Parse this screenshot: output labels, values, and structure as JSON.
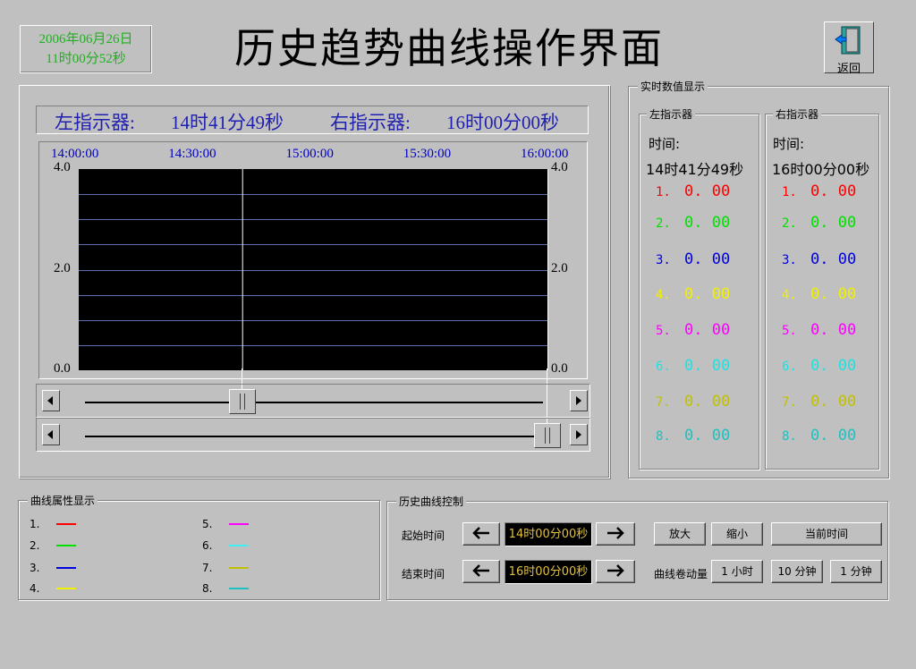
{
  "header": {
    "date": "2006年06月26日",
    "time": "11时00分52秒",
    "title": "历史趋势曲线操作界面",
    "exit_label": "返回"
  },
  "indicators": {
    "left_label": "左指示器:",
    "left_time": "14时41分49秒",
    "right_label": "右指示器:",
    "right_time": "16时00分00秒"
  },
  "chart_data": {
    "type": "line",
    "x_ticks": [
      "14:00:00",
      "14:30:00",
      "15:00:00",
      "15:30:00",
      "16:00:00"
    ],
    "y_ticks_left": [
      "4.0",
      "2.0",
      "0.0"
    ],
    "y_ticks_right": [
      "4.0",
      "2.0",
      "0.0"
    ],
    "ylim": [
      0,
      4
    ],
    "background": "#000000",
    "gridline_color": "#5a6fb0",
    "cursor_left_fraction": 0.348,
    "cursor_right_fraction": 1.0,
    "series": []
  },
  "realtime": {
    "title": "实时数值显示",
    "left": {
      "title": "左指示器",
      "time_label": "时间:",
      "time": "14时41分49秒"
    },
    "right": {
      "title": "右指示器",
      "time_label": "时间:",
      "time": "16时00分00秒"
    },
    "rows": [
      {
        "num": "1.",
        "left": "0. 00",
        "right": "0. 00",
        "color": "#ff0000"
      },
      {
        "num": "2.",
        "left": "0. 00",
        "right": "0. 00",
        "color": "#00e000"
      },
      {
        "num": "3.",
        "left": "0. 00",
        "right": "0. 00",
        "color": "#0000e0"
      },
      {
        "num": "4.",
        "left": "0. 00",
        "right": "0. 00",
        "color": "#f0f000"
      },
      {
        "num": "5.",
        "left": "0. 00",
        "right": "0. 00",
        "color": "#ff00ff"
      },
      {
        "num": "6.",
        "left": "0. 00",
        "right": "0. 00",
        "color": "#20e0e0"
      },
      {
        "num": "7.",
        "left": "0. 00",
        "right": "0. 00",
        "color": "#c0c000"
      },
      {
        "num": "8.",
        "left": "0. 00",
        "right": "0. 00",
        "color": "#20c0c0"
      }
    ]
  },
  "legend": {
    "title": "曲线属性显示",
    "items": [
      {
        "num": "1.",
        "color": "#ff0000"
      },
      {
        "num": "2.",
        "color": "#00e000"
      },
      {
        "num": "3.",
        "color": "#0000e0"
      },
      {
        "num": "4.",
        "color": "#f0f000"
      },
      {
        "num": "5.",
        "color": "#ff00ff"
      },
      {
        "num": "6.",
        "color": "#40f0f0"
      },
      {
        "num": "7.",
        "color": "#c0c000"
      },
      {
        "num": "8.",
        "color": "#20c0c0"
      }
    ]
  },
  "control": {
    "title": "历史曲线控制",
    "start_label": "起始时间",
    "start_time": "14时00分00秒",
    "end_label": "结束时间",
    "end_time": "16时00分00秒",
    "zoom_in": "放大",
    "zoom_out": "缩小",
    "current_time": "当前时间",
    "scroll_label": "曲线卷动量",
    "scroll_1h": "1 小时",
    "scroll_10m": "10 分钟",
    "scroll_1m": "1 分钟"
  },
  "icons": {
    "left_arrow": "arrow-left-icon",
    "right_arrow": "arrow-right-icon",
    "exit": "exit-door-icon"
  }
}
